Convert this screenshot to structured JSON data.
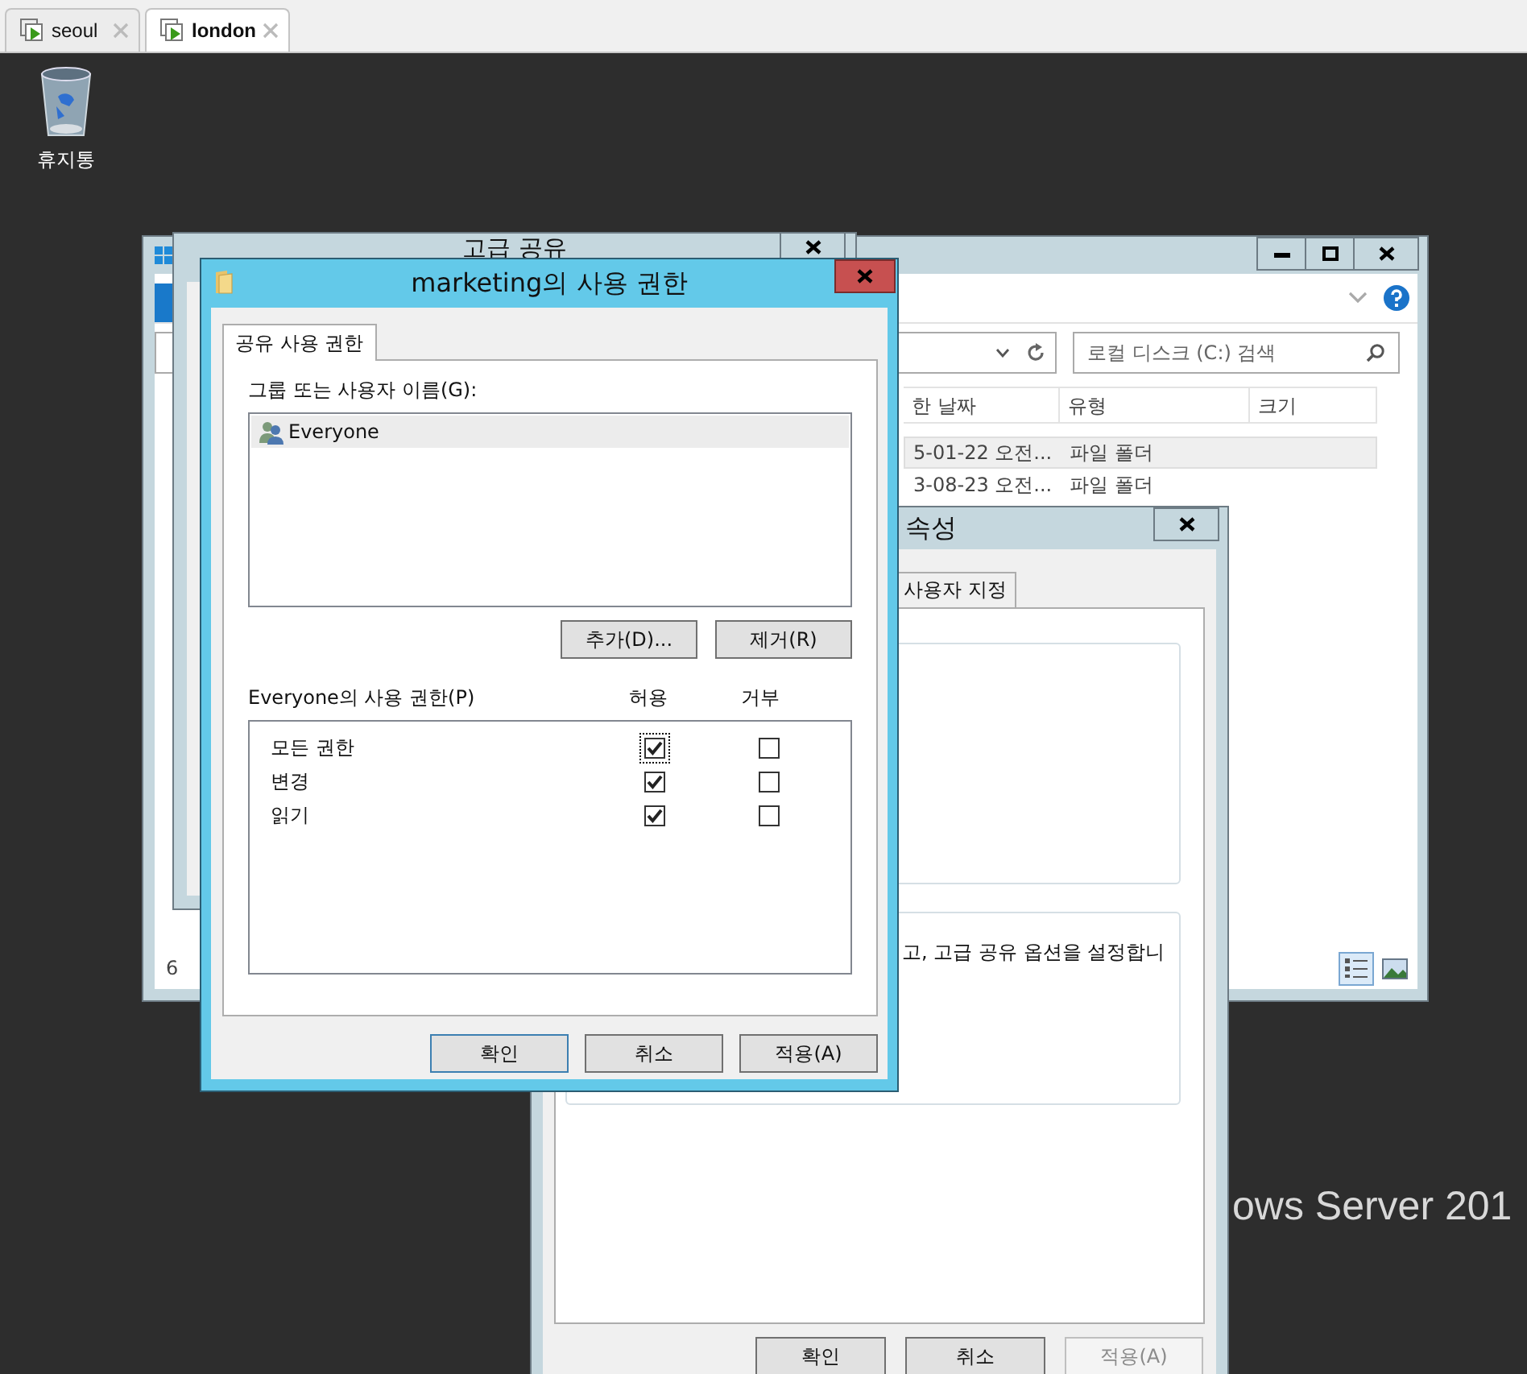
{
  "browser_tabs": [
    {
      "label": "seoul",
      "selected": false
    },
    {
      "label": "london",
      "selected": true
    }
  ],
  "desktop": {
    "icons": [
      {
        "label": "휴지통"
      }
    ],
    "branding": "ows Server 201"
  },
  "explorer": {
    "search": {
      "placeholder": "로컬 디스크 (C:) 검색"
    },
    "columns": [
      "한 날짜",
      "유형",
      "크기"
    ],
    "rows": [
      {
        "cells": [
          "5-01-22 오전...",
          "파일 폴더"
        ],
        "selected": true
      },
      {
        "cells": [
          "3-08-23 오전...",
          "파일 폴더"
        ],
        "selected": false
      }
    ],
    "status": "6"
  },
  "advanced_sharing": {
    "title": "고급 공유"
  },
  "properties": {
    "title": "속성",
    "tab": "사용자 지정",
    "text": "고, 고급 공유 옵션을 설정합니",
    "buttons": [
      {
        "label": "확인",
        "disabled": false
      },
      {
        "label": "취소",
        "disabled": false
      },
      {
        "label": "적용(A)",
        "disabled": true
      }
    ]
  },
  "permissions_dialog": {
    "title": "marketing의 사용 권한",
    "tabs": [
      {
        "label": "공유 사용 권한",
        "selected": true
      }
    ],
    "users_label": "그룹 또는 사용자 이름(G):",
    "users": [
      {
        "name": "Everyone",
        "selected": true
      }
    ],
    "user_buttons": [
      "추가(D)...",
      "제거(R)"
    ],
    "permissions_label": "Everyone의 사용 권한(P)",
    "columns": [
      "허용",
      "거부"
    ],
    "permissions": [
      {
        "name": "모든 권한",
        "allow": true,
        "deny": false,
        "focused": true
      },
      {
        "name": "변경",
        "allow": true,
        "deny": false,
        "focused": false
      },
      {
        "name": "읽기",
        "allow": true,
        "deny": false,
        "focused": false
      }
    ],
    "buttons": [
      {
        "label": "확인",
        "default": true
      },
      {
        "label": "취소",
        "default": false
      },
      {
        "label": "적용(A)",
        "default": false
      }
    ]
  }
}
